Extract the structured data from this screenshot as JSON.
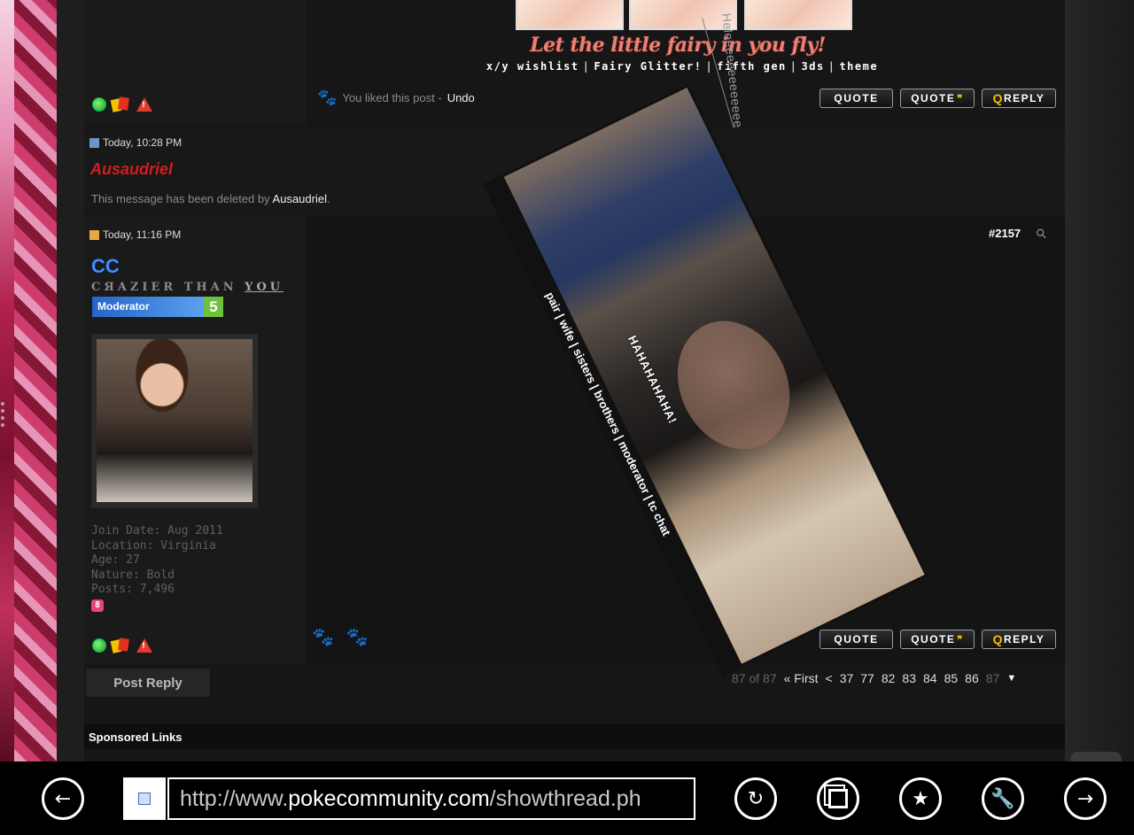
{
  "signature": {
    "title": "Let the little fairy in you fly!",
    "links": [
      "x/y wishlist",
      "Fairy Glitter!",
      "fifth gen",
      "3ds",
      "theme"
    ],
    "hanging_text": "Heleeeeeeeeeeeeeeeee"
  },
  "post1_footer": {
    "liked_text": "You liked this post -",
    "undo_label": "Undo"
  },
  "buttons": {
    "quote": "QUOTE",
    "multi_quote": "QUOTE",
    "quick_reply_q": "Q",
    "quick_reply_rest": "REPLY"
  },
  "deleted_post": {
    "date": "Today, 10:28 PM",
    "author": "Ausaudriel",
    "message_prefix": "This message has been deleted by",
    "message_user": "Ausaudriel",
    "message_suffix": "."
  },
  "post2": {
    "date": "Today, 11:16 PM",
    "post_number": "#2157",
    "username": "CC",
    "user_title_plain": "CЯAZIER THAN ",
    "user_title_underlined": "YOU",
    "badge_label": "Moderator",
    "badge_level": "5",
    "join_date": "Join Date: Aug 2011",
    "location": "Location: Virginia",
    "age": "Age: 27",
    "nature": "Nature: Bold",
    "posts": "Posts: 7,496",
    "mini_badge": "8",
    "gif_caption": "pair | wife | sisters | brothers | moderator | tc chat",
    "gif_overlay": "HAHAHAHAHA!"
  },
  "post_reply_label": "Post Reply",
  "pagination": {
    "page_info": "87 of 87",
    "first_label": "« First",
    "prev": "<",
    "pages": [
      "37",
      "77",
      "82",
      "83",
      "84",
      "85",
      "86"
    ],
    "current": "87"
  },
  "sponsored_label": "Sponsored Links",
  "address_bar": {
    "url_prefix": "http://www.",
    "url_domain": "pokecommunity.com",
    "url_path": "/showthread.ph"
  },
  "taskbar_icons": [
    "back-icon",
    "refresh-icon",
    "tabs-icon",
    "favorite-icon",
    "tools-icon",
    "forward-icon"
  ],
  "colors": {
    "username_red": "#d31e1e",
    "username_blue": "#3f8cff",
    "accent_gold": "#f3c200"
  }
}
